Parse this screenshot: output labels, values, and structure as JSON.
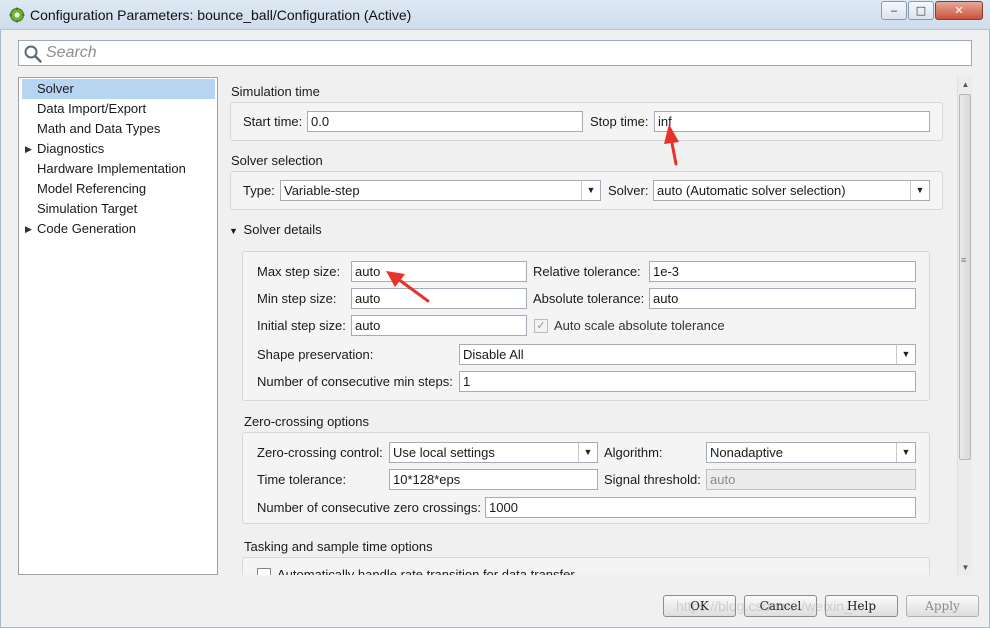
{
  "window": {
    "title": "Configuration Parameters: bounce_ball/Configuration (Active)",
    "controls": {
      "minimize": "‒",
      "maximize": "□",
      "close": "✕"
    }
  },
  "search": {
    "placeholder": "Search"
  },
  "sidebar": {
    "items": [
      {
        "label": "Solver",
        "selected": true,
        "expandable": false
      },
      {
        "label": "Data Import/Export",
        "selected": false,
        "expandable": false
      },
      {
        "label": "Math and Data Types",
        "selected": false,
        "expandable": false
      },
      {
        "label": "Diagnostics",
        "selected": false,
        "expandable": true
      },
      {
        "label": "Hardware Implementation",
        "selected": false,
        "expandable": false
      },
      {
        "label": "Model Referencing",
        "selected": false,
        "expandable": false
      },
      {
        "label": "Simulation Target",
        "selected": false,
        "expandable": false
      },
      {
        "label": "Code Generation",
        "selected": false,
        "expandable": true
      }
    ]
  },
  "simulation_time": {
    "title": "Simulation time",
    "start_label": "Start time:",
    "start_value": "0.0",
    "stop_label": "Stop time:",
    "stop_value": "inf"
  },
  "solver_selection": {
    "title": "Solver selection",
    "type_label": "Type:",
    "type_value": "Variable-step",
    "solver_label": "Solver:",
    "solver_value": "auto (Automatic solver selection)"
  },
  "solver_details": {
    "title": "Solver details",
    "max_step_label": "Max step size:",
    "max_step_value": "auto",
    "min_step_label": "Min step size:",
    "min_step_value": "auto",
    "initial_step_label": "Initial step size:",
    "initial_step_value": "auto",
    "rel_tol_label": "Relative tolerance:",
    "rel_tol_value": "1e-3",
    "abs_tol_label": "Absolute tolerance:",
    "abs_tol_value": "auto",
    "auto_scale_label": "Auto scale absolute tolerance",
    "auto_scale_checked": true,
    "shape_label": "Shape preservation:",
    "shape_value": "Disable All",
    "consec_min_label": "Number of consecutive min steps:",
    "consec_min_value": "1"
  },
  "zero_crossing": {
    "title": "Zero-crossing options",
    "control_label": "Zero-crossing control:",
    "control_value": "Use local settings",
    "algorithm_label": "Algorithm:",
    "algorithm_value": "Nonadaptive",
    "time_tol_label": "Time tolerance:",
    "time_tol_value": "10*128*eps",
    "signal_threshold_label": "Signal threshold:",
    "signal_threshold_value": "auto",
    "consec_zc_label": "Number of consecutive zero crossings:",
    "consec_zc_value": "1000"
  },
  "tasking": {
    "title": "Tasking and sample time options",
    "auto_rate_label": "Automatically handle rate transition for data transfer"
  },
  "buttons": {
    "ok": "OK",
    "cancel": "Cancel",
    "help": "Help",
    "apply": "Apply"
  },
  "watermark": "https://blog.csdn.net/weixin_...",
  "colors": {
    "annotation_arrow": "#e8322b",
    "selection": "#b5d5f2"
  },
  "icons": {
    "app": "simulink-gear-icon",
    "search": "magnifier-icon"
  }
}
